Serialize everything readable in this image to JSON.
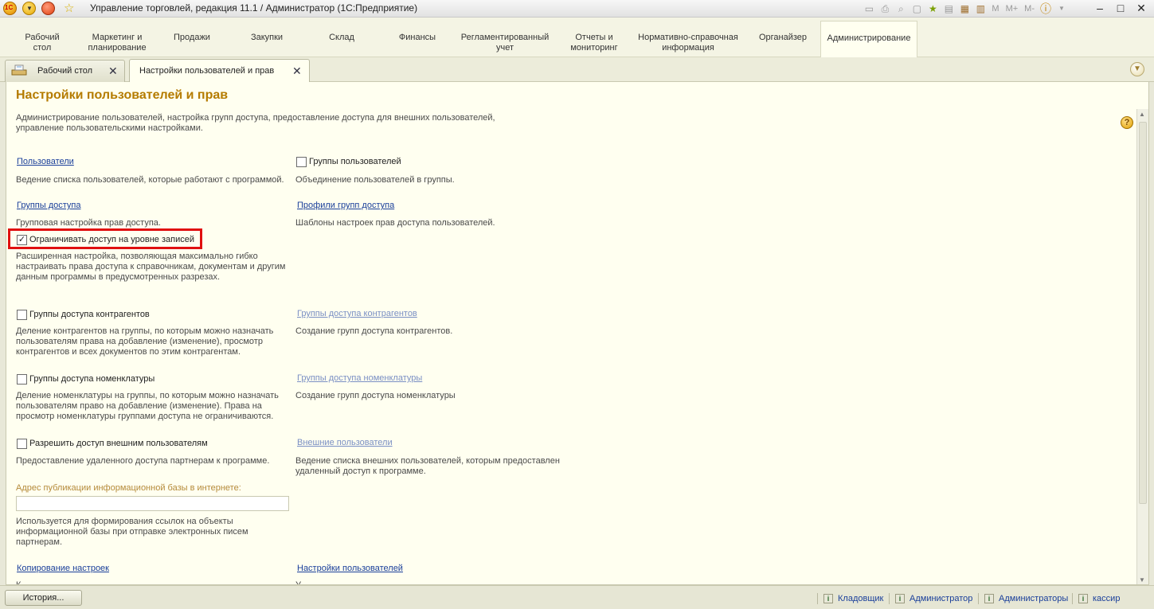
{
  "window": {
    "title": "Управление торговлей, редакция 11.1 / Администратор  (1С:Предприятие)",
    "toolbar_labels": [
      "M",
      "M+",
      "M-"
    ]
  },
  "sections": [
    {
      "label": "Рабочий\nстол"
    },
    {
      "label": "Маркетинг и\nпланирование"
    },
    {
      "label": "Продажи"
    },
    {
      "label": "Закупки"
    },
    {
      "label": "Склад"
    },
    {
      "label": "Финансы"
    },
    {
      "label": "Регламентированный\nучет"
    },
    {
      "label": "Отчеты и\nмониторинг"
    },
    {
      "label": "Нормативно-справочная\nинформация"
    },
    {
      "label": "Органайзер"
    },
    {
      "label": "Администрирование"
    }
  ],
  "tabs": [
    {
      "label": "Рабочий стол"
    },
    {
      "label": "Настройки пользователей и прав"
    }
  ],
  "page": {
    "title": "Настройки пользователей и прав",
    "description": "Администрирование пользователей, настройка групп доступа, предоставление доступа для внешних пользователей,\nуправление пользовательскими настройками."
  },
  "settings": {
    "users_link": "Пользователи",
    "users_desc": "Ведение списка пользователей, которые работают с программой.",
    "user_groups_label": "Группы пользователей",
    "user_groups_desc": "Объединение пользователей в группы.",
    "access_groups_link": "Группы доступа",
    "access_groups_desc": "Групповая настройка прав доступа.",
    "access_profiles_link": "Профили групп доступа",
    "access_profiles_desc": "Шаблоны настроек прав доступа пользователей.",
    "record_level_label": "Ограничивать доступ на уровне записей",
    "record_level_checked": true,
    "record_level_desc": "Расширенная настройка, позволяющая максимально гибко\nнастраивать права доступа к справочникам, документам и другим\nданным программы в предусмотренных разрезах.",
    "contractor_groups_label": "Группы доступа контрагентов",
    "contractor_groups_desc": "Деление контрагентов на группы, по которым можно назначать\nпользователям права на добавление (изменение), просмотр\nконтрагентов и всех документов по этим контрагентам.",
    "contractor_groups_link": "Группы доступа контрагентов",
    "contractor_groups_link_desc": "Создание групп доступа контрагентов.",
    "nomenclature_groups_label": "Группы доступа номенклатуры",
    "nomenclature_groups_desc": "Деление номенклатуры на группы, по которым можно назначать\nпользователям право на добавление (изменение). Права на\nпросмотр номенклатуры группами доступа не ограничиваются.",
    "nomenclature_groups_link": "Группы доступа номенклатуры",
    "nomenclature_groups_link_desc": "Создание групп доступа номенклатуры",
    "external_users_label": "Разрешить доступ внешним пользователям",
    "external_users_desc": "Предоставление удаленного доступа партнерам к программе.",
    "external_users_link": "Внешние пользователи",
    "external_users_link_desc": "Ведение списка внешних пользователей, которым предоставлен\nудаленный доступ к программе.",
    "publication_label": "Адрес публикации информационной базы в интернете:",
    "publication_value": "",
    "publication_desc": "Используется для формирования ссылок на объекты\nинформационной базы при отправке электронных писем\nпартнерам.",
    "copy_settings_link": "Копирование настроек",
    "copy_settings_desc": "К",
    "user_settings_link": "Настройки пользователей",
    "user_settings_desc": "У"
  },
  "statusbar": {
    "history": "История...",
    "items": [
      "Кладовщик",
      "Администратор",
      "Администраторы",
      "кассир"
    ]
  },
  "colors": {
    "title": "#b57b00",
    "link": "#1a3f9a",
    "highlight": "#e01010",
    "background": "#fffff0"
  }
}
